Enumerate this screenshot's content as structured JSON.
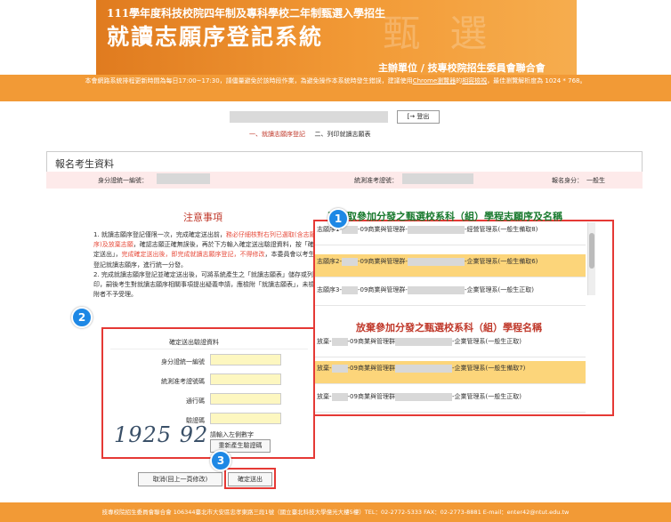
{
  "header": {
    "subtitle": "111學年度科技校院四年制及專科學校二年制甄選入學招生",
    "title": "就讀志願序登記系統",
    "decor": "甄 選",
    "organizer": "主辦單位 / 技專校院招生委員會聯合會"
  },
  "notice": {
    "text": "本會網路系統排程更新時間為每日17:00~17:30，請儘量避免於該時段作業，為避免操作本系統時發生錯誤，建議使用",
    "browser_link": "Chrome瀏覽器",
    "mid": "的",
    "compat_link": "相容檢視",
    "tail": "，最佳瀏覽解析度為 1024 * 768。"
  },
  "toolbar": {
    "logout_label": "[→ 登出"
  },
  "steps": {
    "step1": "一、就讀志願序登記",
    "step2": "二、列印就讀志願表"
  },
  "applicant": {
    "section_title": "報名考生資料",
    "id_label": "身分證統一編號：",
    "exam_no_label": "統測准考證號：",
    "identity_label": "報名身分：",
    "identity_value": "一般生"
  },
  "notes": {
    "title": "注意事項",
    "item1_a": "1. 就讀志願序登記僅限一次，完成確定送出前，",
    "item1_red1": "務必仔細核對右列已選取(含志願序)及放棄志願",
    "item1_b": "，確認志願正確無誤後，再於下方輸入確定送出驗證資料，按「確定送出」，",
    "item1_red2": "完成確定送出後，即完成就讀志願序登記，不得修改",
    "item1_c": "，本委員會以考生登記就讀志願序，進行統一分發。",
    "item2": "2. 完成就讀志願序登記並確定送出後，可將系統產生之「就讀志願表」儲存或列印，嗣後考生對就讀志願序相關事項提出疑義申請，應檢附「就讀志願表」，未檢附者不予受理。"
  },
  "selected": {
    "title": "已選取參加分發之甄選校系科（組）學程志願序及名稱",
    "items": [
      {
        "prefix": "志願序1-",
        "group": "-09商業與管理群-",
        "dept": "-經營管理系(一般生備取8)"
      },
      {
        "prefix": "志願序2-",
        "group": "-09商業與管理群-",
        "dept": "-企業管理系(一般生備取6)"
      },
      {
        "prefix": "志願序3-",
        "group": "-09商業與管理群-",
        "dept": "-企業管理系(一般生正取)"
      }
    ]
  },
  "given_up": {
    "title": "放棄參加分發之甄選校系科（組）學程名稱",
    "items": [
      {
        "prefix": "放棄-",
        "group": "-09商業與管理群",
        "dept": "-企業管理系(一般生正取)"
      },
      {
        "prefix": "放棄-",
        "group": "-09商業與管理群",
        "dept": "-企業管理系(一般生備取7)"
      },
      {
        "prefix": "放棄-",
        "group": "-09商業與管理群",
        "dept": "-企業管理系(一般生正取)"
      }
    ]
  },
  "verify": {
    "title": "確定送出驗證資料",
    "id_label": "身分證統一編號",
    "exam_no_label": "統測准考證號碼",
    "pass_label": "通行碼",
    "captcha_label": "驗證碼",
    "captcha_value": "1925 92",
    "captcha_hint": "請輸入左側數字",
    "refresh_label": "重新產生驗證碼"
  },
  "actions": {
    "cancel_label": "取消(回上一頁修改)",
    "confirm_label": "確定送出"
  },
  "badges": {
    "b1": "1",
    "b2": "2",
    "b3": "3"
  },
  "footer": {
    "text": "技專校院招生委員會聯合會 106344臺北市大安區忠孝東路三段1號（國立臺北科技大學億光大樓5樓）TEL：02-2772-5333 FAX：02-2773-8881 E-mail：enter42@ntut.edu.tw"
  },
  "colors": {
    "accent": "#f29a36",
    "highlight": "#fcd57a",
    "badge": "#1e88e5",
    "callout": "#e53935"
  }
}
